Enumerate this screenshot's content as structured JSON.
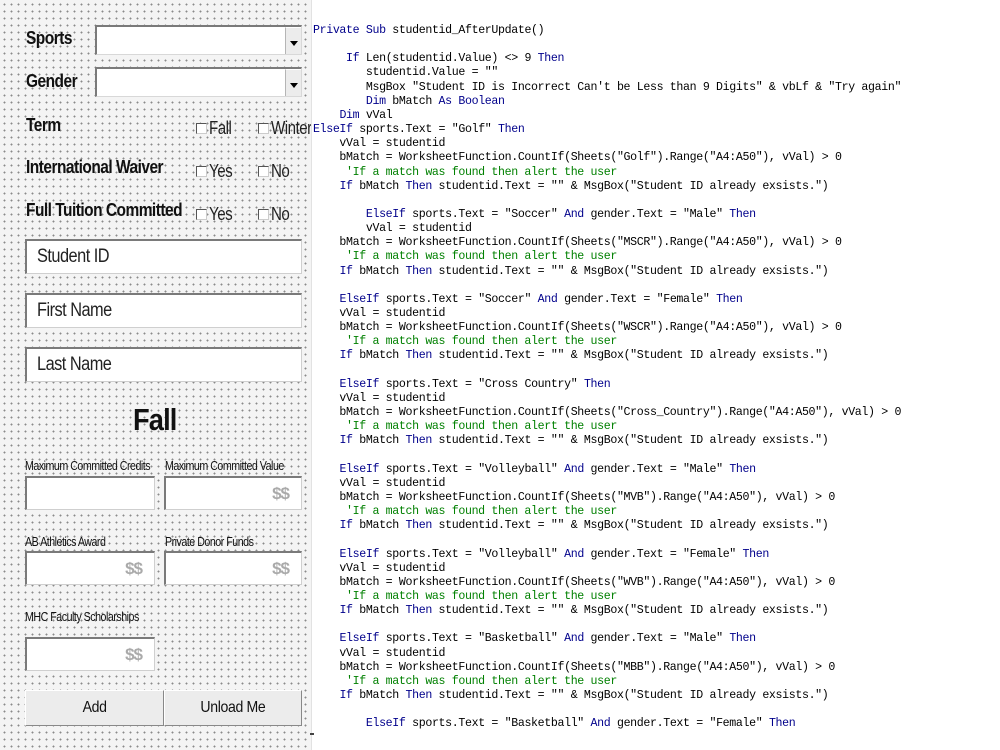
{
  "form": {
    "sports_label": "Sports",
    "gender_label": "Gender",
    "term_label": "Term",
    "term_options": [
      "Fall",
      "Winter"
    ],
    "waiver_label": "International Waiver",
    "waiver_options": [
      "Yes",
      "No"
    ],
    "tuition_label": "Full Tuition Committed",
    "tuition_options": [
      "Yes",
      "No"
    ],
    "student_id_placeholder": "Student ID",
    "first_name_placeholder": "First Name",
    "last_name_placeholder": "Last Name",
    "term_display": "Fall",
    "max_credits_label": "Maximum Committed Credits",
    "max_value_label": "Maximum Committed Value",
    "athletics_award_label": "AB Athletics Award",
    "donor_funds_label": "Private Donor Funds",
    "faculty_scholarships_label": "MHC Faculty Scholarships",
    "currency_symbol": "$$",
    "add_button": "Add",
    "unload_button": "Unload Me"
  },
  "code": {
    "lines": [
      [
        {
          "t": "Private Sub",
          "k": "kw"
        },
        {
          "t": " studentid_AfterUpdate()"
        }
      ],
      [],
      [
        {
          "t": "     "
        },
        {
          "t": "If",
          "k": "kw"
        },
        {
          "t": " Len(studentid.Value) <> 9 "
        },
        {
          "t": "Then",
          "k": "kw"
        }
      ],
      [
        {
          "t": "        studentid.Value = \"\""
        }
      ],
      [
        {
          "t": "        MsgBox \"Student ID is Incorrect Can't be Less than 9 Digits\" & vbLf & \"Try again\""
        }
      ],
      [
        {
          "t": "        "
        },
        {
          "t": "Dim",
          "k": "kw"
        },
        {
          "t": " bMatch "
        },
        {
          "t": "As Boolean",
          "k": "kw"
        }
      ],
      [
        {
          "t": "    "
        },
        {
          "t": "Dim",
          "k": "kw"
        },
        {
          "t": " vVal"
        }
      ],
      [
        {
          "t": "ElseIf",
          "k": "kw"
        },
        {
          "t": " sports.Text = \"Golf\" "
        },
        {
          "t": "Then",
          "k": "kw"
        }
      ],
      [
        {
          "t": "    vVal = studentid"
        }
      ],
      [
        {
          "t": "    bMatch = WorksheetFunction.CountIf(Sheets(\"Golf\").Range(\"A4:A50\"), vVal) > 0"
        }
      ],
      [
        {
          "t": "     'If a match was found then alert the user",
          "k": "cm"
        }
      ],
      [
        {
          "t": "    "
        },
        {
          "t": "If",
          "k": "kw"
        },
        {
          "t": " bMatch "
        },
        {
          "t": "Then",
          "k": "kw"
        },
        {
          "t": " studentid.Text = \"\" & MsgBox(\"Student ID already exsists.\")"
        }
      ],
      [],
      [
        {
          "t": "        "
        },
        {
          "t": "ElseIf",
          "k": "kw"
        },
        {
          "t": " sports.Text = \"Soccer\" "
        },
        {
          "t": "And",
          "k": "kw"
        },
        {
          "t": " gender.Text = \"Male\" "
        },
        {
          "t": "Then",
          "k": "kw"
        }
      ],
      [
        {
          "t": "        vVal = studentid"
        }
      ],
      [
        {
          "t": "    bMatch = WorksheetFunction.CountIf(Sheets(\"MSCR\").Range(\"A4:A50\"), vVal) > 0"
        }
      ],
      [
        {
          "t": "     'If a match was found then alert the user",
          "k": "cm"
        }
      ],
      [
        {
          "t": "    "
        },
        {
          "t": "If",
          "k": "kw"
        },
        {
          "t": " bMatch "
        },
        {
          "t": "Then",
          "k": "kw"
        },
        {
          "t": " studentid.Text = \"\" & MsgBox(\"Student ID already exsists.\")"
        }
      ],
      [],
      [
        {
          "t": "    "
        },
        {
          "t": "ElseIf",
          "k": "kw"
        },
        {
          "t": " sports.Text = \"Soccer\" "
        },
        {
          "t": "And",
          "k": "kw"
        },
        {
          "t": " gender.Text = \"Female\" "
        },
        {
          "t": "Then",
          "k": "kw"
        }
      ],
      [
        {
          "t": "    vVal = studentid"
        }
      ],
      [
        {
          "t": "    bMatch = WorksheetFunction.CountIf(Sheets(\"WSCR\").Range(\"A4:A50\"), vVal) > 0"
        }
      ],
      [
        {
          "t": "     'If a match was found then alert the user",
          "k": "cm"
        }
      ],
      [
        {
          "t": "    "
        },
        {
          "t": "If",
          "k": "kw"
        },
        {
          "t": " bMatch "
        },
        {
          "t": "Then",
          "k": "kw"
        },
        {
          "t": " studentid.Text = \"\" & MsgBox(\"Student ID already exsists.\")"
        }
      ],
      [],
      [
        {
          "t": "    "
        },
        {
          "t": "ElseIf",
          "k": "kw"
        },
        {
          "t": " sports.Text = \"Cross Country\" "
        },
        {
          "t": "Then",
          "k": "kw"
        }
      ],
      [
        {
          "t": "    vVal = studentid"
        }
      ],
      [
        {
          "t": "    bMatch = WorksheetFunction.CountIf(Sheets(\"Cross_Country\").Range(\"A4:A50\"), vVal) > 0"
        }
      ],
      [
        {
          "t": "     'If a match was found then alert the user",
          "k": "cm"
        }
      ],
      [
        {
          "t": "    "
        },
        {
          "t": "If",
          "k": "kw"
        },
        {
          "t": " bMatch "
        },
        {
          "t": "Then",
          "k": "kw"
        },
        {
          "t": " studentid.Text = \"\" & MsgBox(\"Student ID already exsists.\")"
        }
      ],
      [],
      [
        {
          "t": "    "
        },
        {
          "t": "ElseIf",
          "k": "kw"
        },
        {
          "t": " sports.Text = \"Volleyball\" "
        },
        {
          "t": "And",
          "k": "kw"
        },
        {
          "t": " gender.Text = \"Male\" "
        },
        {
          "t": "Then",
          "k": "kw"
        }
      ],
      [
        {
          "t": "    vVal = studentid"
        }
      ],
      [
        {
          "t": "    bMatch = WorksheetFunction.CountIf(Sheets(\"MVB\").Range(\"A4:A50\"), vVal) > 0"
        }
      ],
      [
        {
          "t": "     'If a match was found then alert the user",
          "k": "cm"
        }
      ],
      [
        {
          "t": "    "
        },
        {
          "t": "If",
          "k": "kw"
        },
        {
          "t": " bMatch "
        },
        {
          "t": "Then",
          "k": "kw"
        },
        {
          "t": " studentid.Text = \"\" & MsgBox(\"Student ID already exsists.\")"
        }
      ],
      [],
      [
        {
          "t": "    "
        },
        {
          "t": "ElseIf",
          "k": "kw"
        },
        {
          "t": " sports.Text = \"Volleyball\" "
        },
        {
          "t": "And",
          "k": "kw"
        },
        {
          "t": " gender.Text = \"Female\" "
        },
        {
          "t": "Then",
          "k": "kw"
        }
      ],
      [
        {
          "t": "    vVal = studentid"
        }
      ],
      [
        {
          "t": "    bMatch = WorksheetFunction.CountIf(Sheets(\"WVB\").Range(\"A4:A50\"), vVal) > 0"
        }
      ],
      [
        {
          "t": "     'If a match was found then alert the user",
          "k": "cm"
        }
      ],
      [
        {
          "t": "    "
        },
        {
          "t": "If",
          "k": "kw"
        },
        {
          "t": " bMatch "
        },
        {
          "t": "Then",
          "k": "kw"
        },
        {
          "t": " studentid.Text = \"\" & MsgBox(\"Student ID already exsists.\")"
        }
      ],
      [],
      [
        {
          "t": "    "
        },
        {
          "t": "ElseIf",
          "k": "kw"
        },
        {
          "t": " sports.Text = \"Basketball\" "
        },
        {
          "t": "And",
          "k": "kw"
        },
        {
          "t": " gender.Text = \"Male\" "
        },
        {
          "t": "Then",
          "k": "kw"
        }
      ],
      [
        {
          "t": "    vVal = studentid"
        }
      ],
      [
        {
          "t": "    bMatch = WorksheetFunction.CountIf(Sheets(\"MBB\").Range(\"A4:A50\"), vVal) > 0"
        }
      ],
      [
        {
          "t": "     'If a match was found then alert the user",
          "k": "cm"
        }
      ],
      [
        {
          "t": "    "
        },
        {
          "t": "If",
          "k": "kw"
        },
        {
          "t": " bMatch "
        },
        {
          "t": "Then",
          "k": "kw"
        },
        {
          "t": " studentid.Text = \"\" & MsgBox(\"Student ID already exsists.\")"
        }
      ],
      [],
      [
        {
          "t": "        "
        },
        {
          "t": "ElseIf",
          "k": "kw"
        },
        {
          "t": " sports.Text = \"Basketball\" "
        },
        {
          "t": "And",
          "k": "kw"
        },
        {
          "t": " gender.Text = \"Female\" "
        },
        {
          "t": "Then",
          "k": "kw"
        }
      ]
    ]
  }
}
